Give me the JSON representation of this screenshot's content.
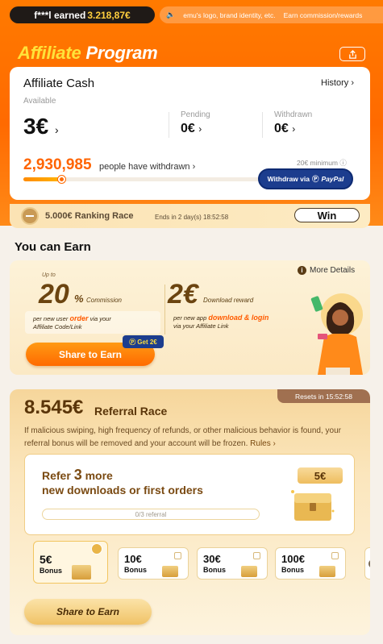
{
  "ticker": {
    "earned_prefix": "f***l earned",
    "earned_amount": "3.218,87€",
    "messages": [
      "emu's logo, brand identity, etc.",
      "Earn commission/rewards"
    ]
  },
  "title": {
    "part1": "Affiliate",
    "part2": "Program"
  },
  "cash": {
    "title": "Affiliate Cash",
    "history_label": "History",
    "available_label": "Available",
    "available_value": "3€",
    "pending_label": "Pending",
    "pending_value": "0€",
    "withdrawn_label": "Withdrawn",
    "withdrawn_value": "0€",
    "people_count": "2,930,985",
    "people_text": "people have withdrawn",
    "minimum_text": "20€ minimum",
    "progress_fraction": 0.16,
    "paypal_button_prefix": "Withdraw via",
    "paypal_brand": "PayPal"
  },
  "ranking": {
    "label": "5.000€ Ranking Race",
    "ends_text": "Ends in 2 day(s) 18:52:58",
    "win_label": "Win"
  },
  "earn": {
    "heading": "You can Earn",
    "more_details": "More Details",
    "upto": "Up to",
    "commission_value": "20",
    "commission_symbol": "%",
    "commission_label": "Commission",
    "commission_sub_pre": "per new user",
    "commission_sub_hl": "order",
    "commission_sub_post": "via your",
    "commission_sub_line2": "Affiliate Code/Link",
    "download_value": "2€",
    "download_label": "Download reward",
    "download_sub_pre": "per new app",
    "download_sub_hl": "download & login",
    "download_sub_line2": "via your Affiliate Link",
    "share_label": "Share to Earn",
    "get_badge": "Get 2€"
  },
  "race": {
    "resets": "Resets in 15:52:58",
    "amount": "8.545€",
    "title": "Referral Race",
    "warning": "If malicious swiping, high frequency of refunds, or other malicious behavior is found, your referral bonus will be removed and your account will be frozen.",
    "rules_label": "Rules",
    "refer_pre": "Refer",
    "refer_count": "3",
    "refer_post": "more",
    "refer_line2": "new downloads or first orders",
    "progress_text": "0/3 referral",
    "reward_value": "5€",
    "bonuses": [
      {
        "value": "5€",
        "label": "Bonus"
      },
      {
        "value": "10€",
        "label": "Bonus"
      },
      {
        "value": "30€",
        "label": "Bonus"
      },
      {
        "value": "100€",
        "label": "Bonus"
      }
    ],
    "share_label": "Share to Earn"
  },
  "colors": {
    "brand_orange": "#ff6a00",
    "paypal_blue": "#1c3d8e",
    "gold": "#f0c266"
  }
}
